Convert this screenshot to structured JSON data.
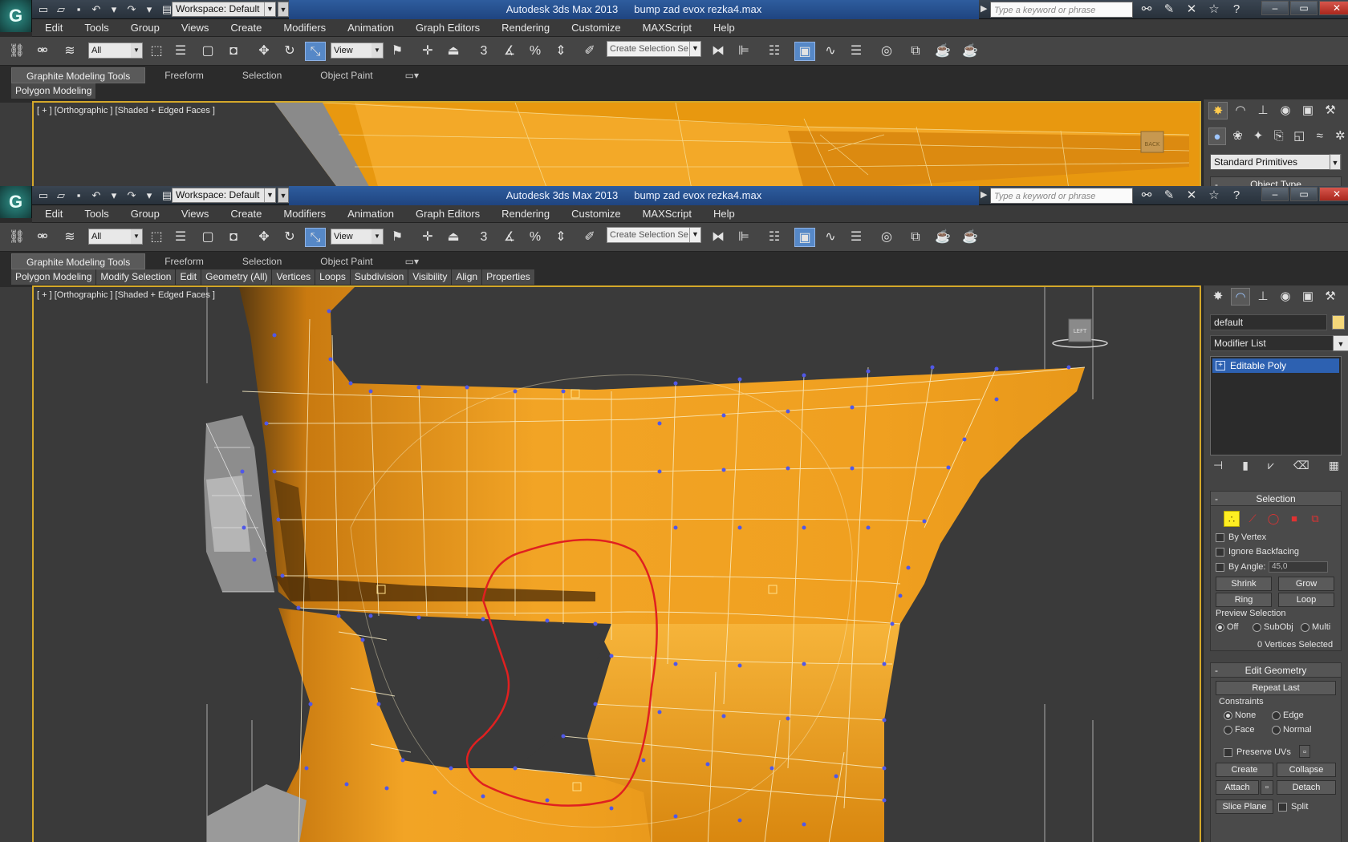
{
  "window": {
    "app_title": "Autodesk 3ds Max  2013",
    "file_title": "bump zad evox rezka4.max",
    "workspace": "Workspace: Default",
    "search_placeholder": "Type a keyword or phrase",
    "logo_glyph": "G"
  },
  "menu": [
    "Edit",
    "Tools",
    "Group",
    "Views",
    "Create",
    "Modifiers",
    "Animation",
    "Graph Editors",
    "Rendering",
    "Customize",
    "MAXScript",
    "Help"
  ],
  "toolbar": {
    "filter": "All",
    "ref_coord": "View",
    "selection_set": "Create Selection Se",
    "snap_labels": [
      "3",
      "%"
    ]
  },
  "ribbon": {
    "tabs": [
      "Graphite Modeling Tools",
      "Freeform",
      "Selection",
      "Object Paint"
    ],
    "top_panel": [
      "Polygon Modeling"
    ],
    "main_panel": [
      "Polygon Modeling",
      "Modify Selection",
      "Edit",
      "Geometry (All)",
      "Vertices",
      "Loops",
      "Subdivision",
      "Visibility",
      "Align",
      "Properties"
    ]
  },
  "viewport": {
    "label": "[ + ] [Orthographic ] [Shaded + Edged Faces ]",
    "viewcube_top": "BACK",
    "viewcube_main": "LEFT"
  },
  "create_panel": {
    "category": "Standard Primitives",
    "rollout": "Object Type"
  },
  "modify_panel": {
    "object_name": "default",
    "modifier_list": "Modifier List",
    "stack_item": "Editable Poly",
    "selection": {
      "title": "Selection",
      "by_vertex": "By Vertex",
      "ignore_backfacing": "Ignore Backfacing",
      "by_angle": "By Angle:",
      "angle_value": "45,0",
      "shrink": "Shrink",
      "grow": "Grow",
      "ring": "Ring",
      "loop": "Loop",
      "preview_title": "Preview Selection",
      "preview_off": "Off",
      "preview_subobj": "SubObj",
      "preview_multi": "Multi",
      "status": "0 Vertices Selected"
    },
    "edit_geometry": {
      "title": "Edit Geometry",
      "repeat_last": "Repeat Last",
      "constraints": "Constraints",
      "none": "None",
      "edge": "Edge",
      "face": "Face",
      "normal": "Normal",
      "preserve_uvs": "Preserve UVs",
      "create": "Create",
      "collapse": "Collapse",
      "attach": "Attach",
      "detach": "Detach",
      "slice_plane": "Slice Plane",
      "split": "Split"
    }
  },
  "colors": {
    "viewport_bg": "#3a3a3a",
    "mesh_orange": "#f0a020",
    "vertex_blue": "#5058e8",
    "annotation_red": "#e02020",
    "active_viewport_border": "#d4a82a"
  }
}
